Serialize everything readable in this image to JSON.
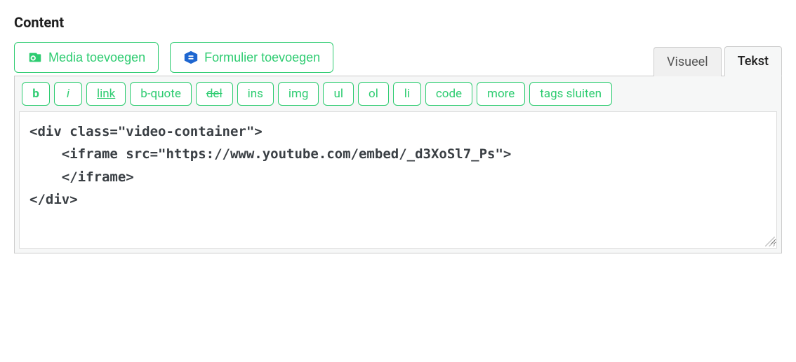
{
  "section": {
    "title": "Content"
  },
  "buttons": {
    "add_media": "Media toevoegen",
    "add_form": "Formulier toevoegen"
  },
  "tabs": {
    "visual": "Visueel",
    "text": "Tekst"
  },
  "format": {
    "bold": "b",
    "italic": "i",
    "link": "link",
    "bquote": "b-quote",
    "del": "del",
    "ins": "ins",
    "img": "img",
    "ul": "ul",
    "ol": "ol",
    "li": "li",
    "code": "code",
    "more": "more",
    "close_tags": "tags sluiten"
  },
  "editor": {
    "content": "<div class=\"video-container\">\n    <iframe src=\"https://www.youtube.com/embed/_d3XoSl7_Ps\">\n    </iframe>\n</div>"
  }
}
